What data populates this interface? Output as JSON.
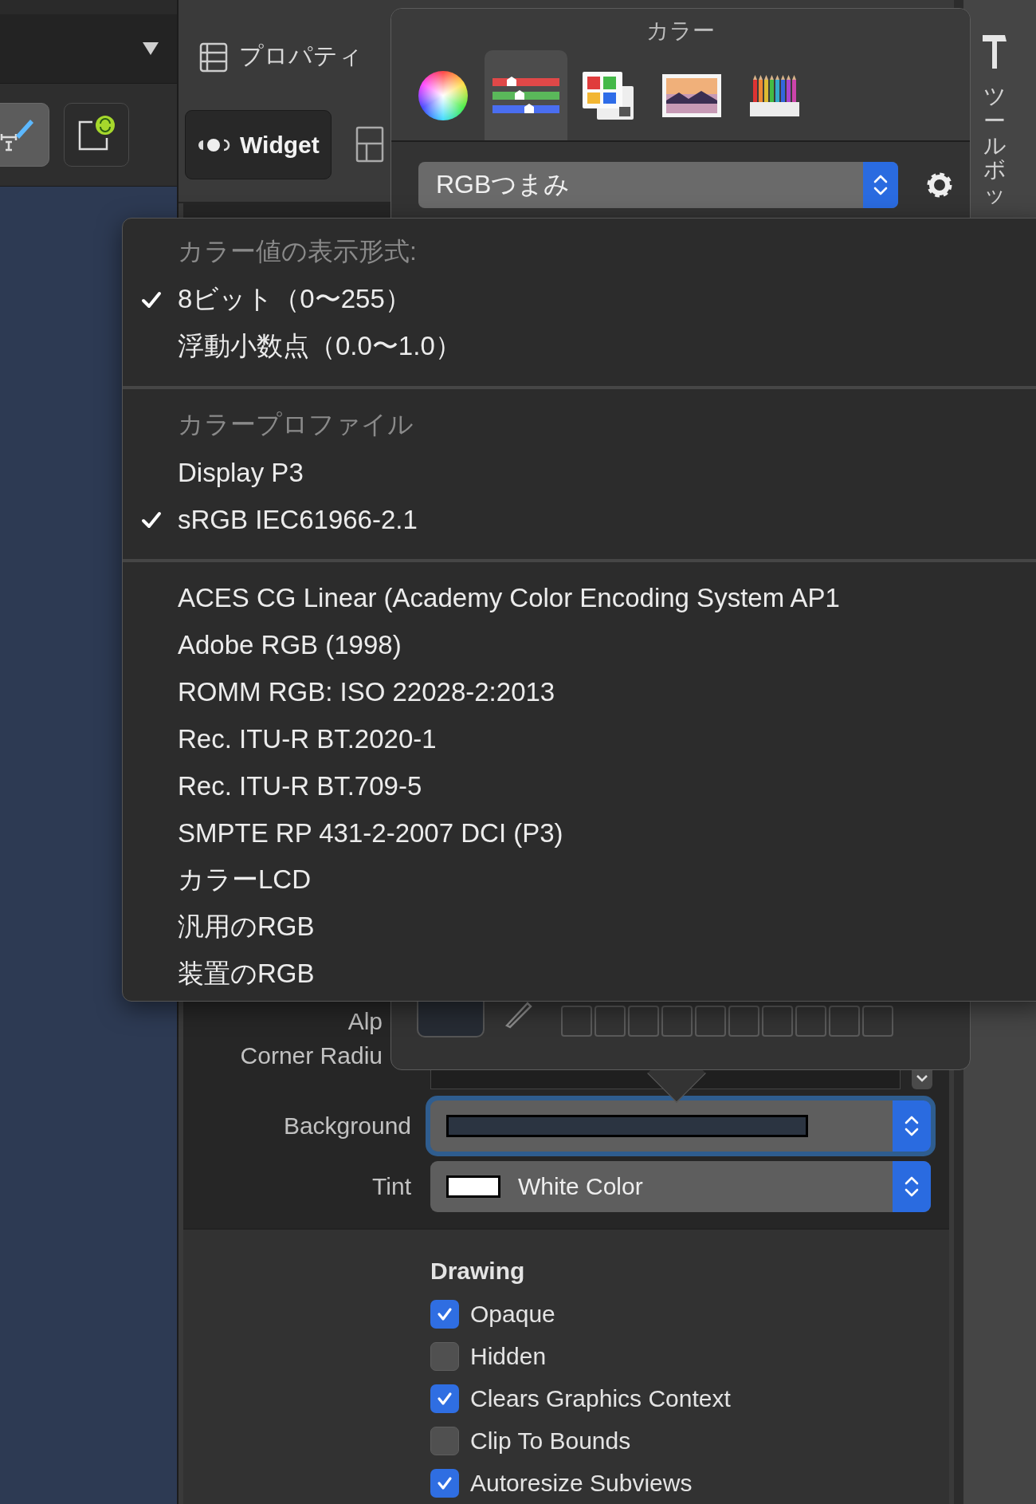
{
  "left_pane": {
    "toolbar_buttons": [
      {
        "selected": true
      },
      {
        "selected": false
      }
    ]
  },
  "inspector": {
    "title": "プロパティ",
    "widget_button": "Widget",
    "rows": [
      {
        "kind": "label",
        "label": "Alp"
      },
      {
        "kind": "number",
        "label": "Corner Radiu"
      },
      {
        "kind": "color",
        "label": "Background",
        "color": "#2b3441",
        "focused": true
      },
      {
        "kind": "color",
        "label": "Tint",
        "color": "#ffffff",
        "value": "White Color",
        "focused": false
      }
    ],
    "drawing": {
      "title": "Drawing",
      "options": [
        {
          "label": "Opaque",
          "checked": true
        },
        {
          "label": "Hidden",
          "checked": false
        },
        {
          "label": "Clears Graphics Context",
          "checked": true
        },
        {
          "label": "Clip To Bounds",
          "checked": false
        },
        {
          "label": "Autoresize Subviews",
          "checked": true
        }
      ]
    }
  },
  "toolbox": {
    "title": "ツールボッ"
  },
  "color_panel": {
    "title": "カラー",
    "tabs": [
      {
        "selected": false
      },
      {
        "selected": true
      },
      {
        "selected": false
      },
      {
        "selected": false
      },
      {
        "selected": false
      }
    ],
    "mode": "RGBつまみ"
  },
  "menu": {
    "sections": [
      {
        "header": "カラー値の表示形式:",
        "items": [
          {
            "label": "8ビット（0〜255）",
            "checked": true
          },
          {
            "label": "浮動小数点（0.0〜1.0）",
            "checked": false
          }
        ]
      },
      {
        "header": "カラープロファイル",
        "items": [
          {
            "label": "Display P3",
            "checked": false
          },
          {
            "label": "sRGB IEC61966-2.1",
            "checked": true
          }
        ]
      },
      {
        "items": [
          {
            "label": "ACES CG Linear (Academy Color Encoding System AP1",
            "checked": false
          },
          {
            "label": "Adobe RGB (1998)",
            "checked": false
          },
          {
            "label": "ROMM RGB: ISO 22028-2:2013",
            "checked": false
          },
          {
            "label": "Rec. ITU-R BT.2020-1",
            "checked": false
          },
          {
            "label": "Rec. ITU-R BT.709-5",
            "checked": false
          },
          {
            "label": "SMPTE RP 431-2-2007 DCI (P3)",
            "checked": false
          },
          {
            "label": "カラーLCD",
            "checked": false
          },
          {
            "label": "汎用のRGB",
            "checked": false
          },
          {
            "label": "装置のRGB",
            "checked": false
          }
        ]
      }
    ]
  }
}
